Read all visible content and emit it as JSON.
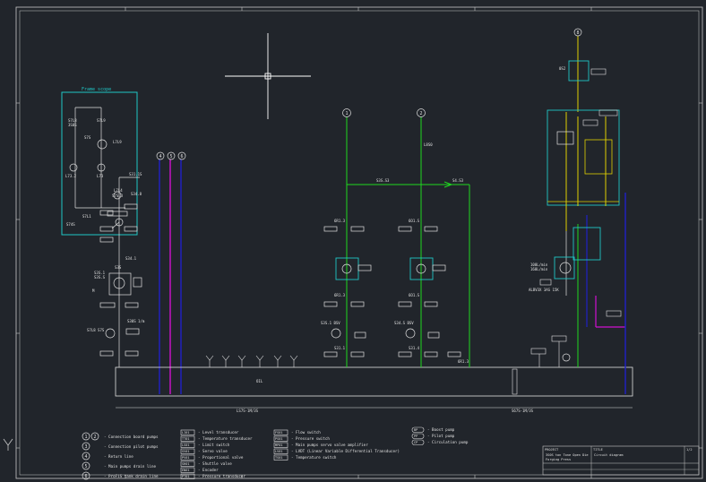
{
  "colors": {
    "background": "#21252b",
    "frame": "#c8c8c8",
    "line_white": "#e0e0e0",
    "green": "#1fd81f",
    "magenta": "#d010d0",
    "blue": "#2020c8",
    "cyan": "#1fc6c6",
    "yellow": "#e0d000"
  },
  "diagram": {
    "frame_scope_label": "Frame scope",
    "tank_label": "OIL",
    "branch_labels": [
      "1",
      "2"
    ],
    "top_right_circle_label": "8",
    "pipe_circles": [
      "4",
      "5",
      "6"
    ],
    "bottom_left_code": "LS7S-1M/3S",
    "bottom_right_code": "S67S-1M/3S",
    "motor_left_code": "ALBV3X 3AS 15K",
    "top_value": "0S2",
    "flow_label_left": "100L/min",
    "flow_label_right": "160L/min"
  },
  "legend_circles": [
    {
      "num": "1",
      "num2": "2",
      "text": "- Connection board pumps"
    },
    {
      "num": "3",
      "text": "- Connection pilot pumps"
    },
    {
      "num": "4",
      "text": "- Return line"
    },
    {
      "num": "5",
      "text": "- Main pumps drain line"
    },
    {
      "num": "6",
      "text": "- ProFiS tank drain line"
    }
  ],
  "legend_codes_a": [
    {
      "code": "LI01",
      "text": "- Level transducer"
    },
    {
      "code": "TT01",
      "text": "- Temperature transducer"
    },
    {
      "code": "LS01",
      "text": "- Limit switch"
    },
    {
      "code": "SV01",
      "text": "- Servo valve"
    },
    {
      "code": "PV01",
      "text": "- Proportional valve"
    },
    {
      "code": "SH01",
      "text": "- Shuttle valve"
    },
    {
      "code": "EN01",
      "text": "- Encoder"
    },
    {
      "code": "PT01",
      "text": "- Pressure transducer"
    }
  ],
  "legend_codes_b": [
    {
      "code": "FS01",
      "text": "- Flow switch"
    },
    {
      "code": "PS01",
      "text": "- Pressure switch"
    },
    {
      "code": "MP01",
      "text": "- Main pumps servo valve amplifier"
    },
    {
      "code": "LV01",
      "text": "- LVDT (Linear Variable Differential Transducer)"
    },
    {
      "code": "TS01",
      "text": "- Temperature switch"
    }
  ],
  "legend_pumps": [
    {
      "code": "BP",
      "text": "- Boost pump"
    },
    {
      "code": "PP",
      "text": "- Pilot pump"
    },
    {
      "code": "CP",
      "text": "- Circulation pump"
    }
  ],
  "title_block": {
    "project_label": "PROJECT",
    "project_line1": "3S0S ton Tone Open Die",
    "project_line2": "Forging Press",
    "title_label": "TITLE",
    "title_text": "Circuit diagram",
    "sheet": "1/2"
  }
}
